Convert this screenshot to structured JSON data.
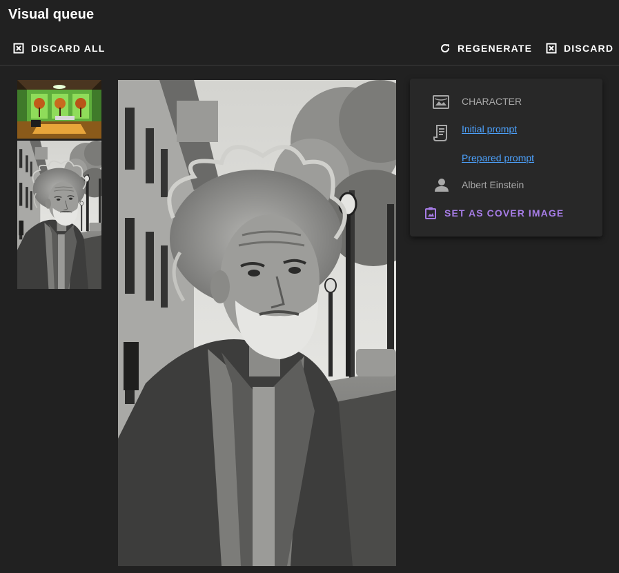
{
  "header": {
    "title": "Visual queue"
  },
  "toolbar": {
    "discard_all_label": "DISCARD ALL",
    "regenerate_label": "REGENERATE",
    "discard_label": "DISCARD"
  },
  "thumbnails": [
    {
      "name": "interior-scene-thumbnail"
    },
    {
      "name": "old-man-portrait-thumbnail"
    }
  ],
  "details": {
    "type_label": "CHARACTER",
    "initial_prompt_link": "Initial prompt",
    "prepared_prompt_link": "Prepared prompt",
    "character_name": "Albert Einstein",
    "cover_button_label": "SET AS COVER IMAGE",
    "icons": [
      "image-icon",
      "scroll-icon",
      "person-icon",
      "cover-image-icon"
    ]
  },
  "colors": {
    "background": "#212121",
    "card": "#282828",
    "link": "#4da3ff",
    "accent": "#a67ce6",
    "muted_text": "#a8a8a8"
  }
}
